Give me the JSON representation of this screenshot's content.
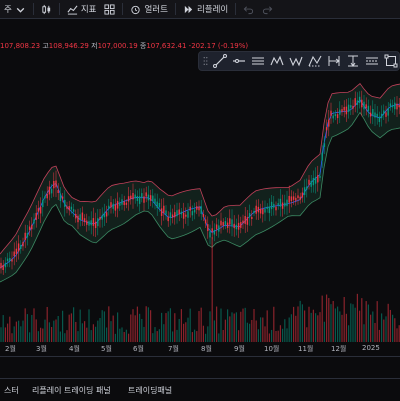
{
  "toolbar": {
    "interval_label": "주",
    "indicators_label": "지표",
    "alert_label": "얼러트",
    "replay_label": "리플레이"
  },
  "ohlc": {
    "open_partial": "107,808.23",
    "high_label": "고",
    "high_value": "108,946.29",
    "low_label": "저",
    "low_value": "107,000.19",
    "close_label": "종",
    "close_value": "107,632.41",
    "change": "-202.17 (-0.19%)"
  },
  "drawing_tools": [
    "trend-line-icon",
    "horizontal-ray-icon",
    "parallel-channel-icon",
    "pattern-icon",
    "zigzag-pattern-icon",
    "projection-icon",
    "date-range-icon",
    "price-range-icon",
    "bars-pattern-icon",
    "rectangle-icon"
  ],
  "x_axis": [
    "2월",
    "3월",
    "4월",
    "5월",
    "6월",
    "7월",
    "8월",
    "9월",
    "10월",
    "11월",
    "12월",
    "2025"
  ],
  "bottom_tabs": [
    "스터",
    "리플레이 트레이딩 패널",
    "트레이딩패널"
  ],
  "colors": {
    "up": "#089981",
    "down": "#f23645",
    "band_outer": "#c2415a",
    "band_fill": "#1f4a3a",
    "ma": "#2962ff"
  }
}
